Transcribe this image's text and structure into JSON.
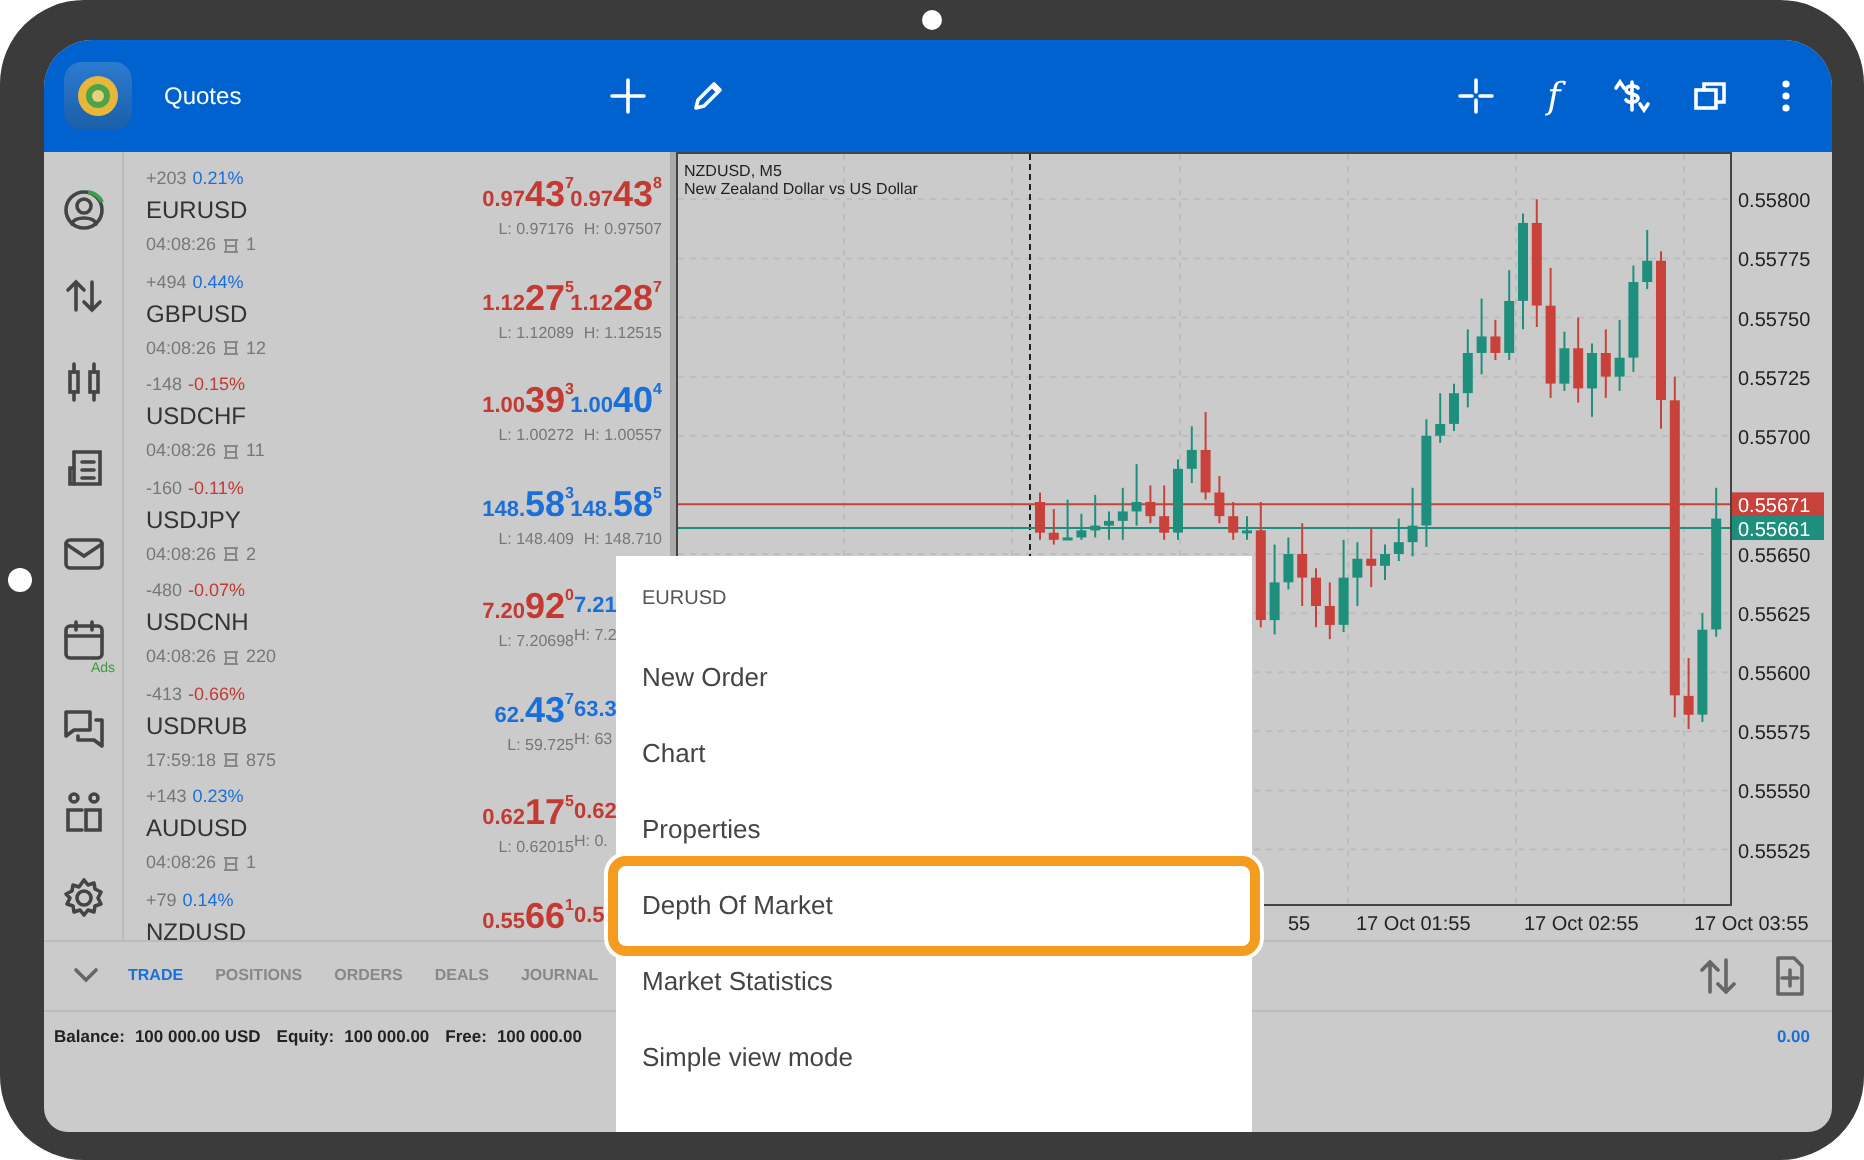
{
  "header": {
    "title": "Quotes",
    "indicator_symbol": "f"
  },
  "nav_rail": [
    {
      "kind": "account"
    },
    {
      "kind": "quotes"
    },
    {
      "kind": "chart"
    },
    {
      "kind": "trade"
    },
    {
      "kind": "mail"
    },
    {
      "kind": "calendar",
      "badge": "Ads"
    },
    {
      "kind": "chat"
    },
    {
      "kind": "community"
    },
    {
      "kind": "settings"
    }
  ],
  "quotes": [
    {
      "points": "+203",
      "percent": "0.21%",
      "rising": true,
      "symbol": "EURUSD",
      "time": "04:08:26",
      "spread": "1",
      "bid": {
        "prefix": "0.97",
        "big": "43",
        "sup": "7",
        "rising": false
      },
      "ask": {
        "prefix": "0.97",
        "big": "43",
        "sup": "8",
        "rising": false
      },
      "low": "L: 0.97176",
      "high": "H: 0.97507"
    },
    {
      "points": "+494",
      "percent": "0.44%",
      "rising": true,
      "symbol": "GBPUSD",
      "time": "04:08:26",
      "spread": "12",
      "bid": {
        "prefix": "1.12",
        "big": "27",
        "sup": "5",
        "rising": false
      },
      "ask": {
        "prefix": "1.12",
        "big": "28",
        "sup": "7",
        "rising": false
      },
      "low": "L: 1.12089",
      "high": "H: 1.12515"
    },
    {
      "points": "-148",
      "percent": "-0.15%",
      "rising": false,
      "symbol": "USDCHF",
      "time": "04:08:26",
      "spread": "11",
      "bid": {
        "prefix": "1.00",
        "big": "39",
        "sup": "3",
        "rising": false
      },
      "ask": {
        "prefix": "1.00",
        "big": "40",
        "sup": "4",
        "rising": true
      },
      "low": "L: 1.00272",
      "high": "H: 1.00557"
    },
    {
      "points": "-160",
      "percent": "-0.11%",
      "rising": false,
      "symbol": "USDJPY",
      "time": "04:08:26",
      "spread": "2",
      "bid": {
        "prefix": "148.",
        "big": "58",
        "sup": "3",
        "rising": true
      },
      "ask": {
        "prefix": "148.",
        "big": "58",
        "sup": "5",
        "rising": true
      },
      "low": "L: 148.409",
      "high": "H: 148.710"
    },
    {
      "points": "-480",
      "percent": "-0.07%",
      "rising": false,
      "symbol": "USDCNH",
      "time": "04:08:26",
      "spread": "220",
      "bid": {
        "prefix": "7.20",
        "big": "92",
        "sup": "0",
        "rising": false
      },
      "ask": {
        "prefix": "7.21",
        "rising": true
      },
      "low": "L: 7.20698",
      "high": "H: 7.2"
    },
    {
      "points": "-413",
      "percent": "-0.66%",
      "rising": false,
      "symbol": "USDRUB",
      "time": "17:59:18",
      "spread": "875",
      "bid": {
        "prefix": "62.",
        "big": "43",
        "sup": "7",
        "rising": true
      },
      "ask": {
        "prefix": "63.3",
        "rising": true
      },
      "low": "L: 59.725",
      "high": "H: 63"
    },
    {
      "points": "+143",
      "percent": "0.23%",
      "rising": true,
      "symbol": "AUDUSD",
      "time": "04:08:26",
      "spread": "1",
      "bid": {
        "prefix": "0.62",
        "big": "17",
        "sup": "5",
        "rising": false
      },
      "ask": {
        "prefix": "0.62",
        "rising": false
      },
      "low": "L: 0.62015",
      "high": "H: 0."
    },
    {
      "points": "+79",
      "percent": "0.14%",
      "rising": true,
      "symbol": "NZDUSD",
      "bid": {
        "prefix": "0.55",
        "big": "66",
        "sup": "1",
        "rising": false
      },
      "ask": {
        "prefix": "0.5",
        "rising": false
      }
    }
  ],
  "chart": {
    "symbol": "NZDUSD, M5",
    "description": "New Zealand Dollar vs US Dollar",
    "x_labels": [
      "55",
      "17 Oct 01:55",
      "17 Oct 02:55",
      "17 Oct 03:55"
    ],
    "chart_data": {
      "type": "candlestick",
      "grid": true,
      "ylim": [
        0.55502,
        0.5582
      ],
      "ohlc": [
        [
          0.55672,
          0.55676,
          0.55656,
          0.55659
        ],
        [
          0.55659,
          0.55669,
          0.55654,
          0.55656
        ],
        [
          0.55656,
          0.55673,
          0.55656,
          0.55657
        ],
        [
          0.55657,
          0.55667,
          0.55656,
          0.5566
        ],
        [
          0.5566,
          0.55675,
          0.55657,
          0.55662
        ],
        [
          0.55662,
          0.55668,
          0.55656,
          0.55664
        ],
        [
          0.55664,
          0.55678,
          0.55656,
          0.55668
        ],
        [
          0.55668,
          0.55688,
          0.55662,
          0.55672
        ],
        [
          0.55672,
          0.55679,
          0.55663,
          0.55666
        ],
        [
          0.55666,
          0.55679,
          0.55656,
          0.55659
        ],
        [
          0.55659,
          0.5569,
          0.55656,
          0.55686
        ],
        [
          0.55686,
          0.55704,
          0.5568,
          0.55694
        ],
        [
          0.55694,
          0.5571,
          0.55673,
          0.55676
        ],
        [
          0.55676,
          0.55683,
          0.55663,
          0.55666
        ],
        [
          0.55666,
          0.55672,
          0.55656,
          0.55659
        ],
        [
          0.55659,
          0.55666,
          0.55656,
          0.5566
        ],
        [
          0.5566,
          0.55672,
          0.55619,
          0.55622
        ],
        [
          0.55622,
          0.55654,
          0.55616,
          0.55638
        ],
        [
          0.55638,
          0.55657,
          0.55635,
          0.5565
        ],
        [
          0.5565,
          0.55663,
          0.55628,
          0.5564
        ],
        [
          0.5564,
          0.55644,
          0.55619,
          0.55628
        ],
        [
          0.55628,
          0.55638,
          0.55614,
          0.5562
        ],
        [
          0.5562,
          0.55656,
          0.55617,
          0.5564
        ],
        [
          0.5564,
          0.55655,
          0.55628,
          0.55648
        ],
        [
          0.55648,
          0.55661,
          0.55636,
          0.55645
        ],
        [
          0.55645,
          0.55654,
          0.55639,
          0.5565
        ],
        [
          0.5565,
          0.55665,
          0.55647,
          0.55655
        ],
        [
          0.55655,
          0.55678,
          0.55649,
          0.55662
        ],
        [
          0.55662,
          0.55707,
          0.55653,
          0.557
        ],
        [
          0.557,
          0.55718,
          0.55697,
          0.55705
        ],
        [
          0.55705,
          0.55722,
          0.55702,
          0.55718
        ],
        [
          0.55718,
          0.55745,
          0.55712,
          0.55735
        ],
        [
          0.55735,
          0.55758,
          0.55726,
          0.55742
        ],
        [
          0.55742,
          0.55749,
          0.55732,
          0.55735
        ],
        [
          0.55735,
          0.5577,
          0.55732,
          0.55757
        ],
        [
          0.55757,
          0.55794,
          0.55745,
          0.5579
        ],
        [
          0.5579,
          0.558,
          0.55746,
          0.55755
        ],
        [
          0.55755,
          0.55771,
          0.55716,
          0.55722
        ],
        [
          0.55722,
          0.55744,
          0.55719,
          0.55737
        ],
        [
          0.55737,
          0.5575,
          0.55714,
          0.5572
        ],
        [
          0.5572,
          0.55739,
          0.55708,
          0.55735
        ],
        [
          0.55735,
          0.55745,
          0.55716,
          0.55725
        ],
        [
          0.55725,
          0.55749,
          0.55719,
          0.55733
        ],
        [
          0.55733,
          0.55772,
          0.55727,
          0.55765
        ],
        [
          0.55765,
          0.55787,
          0.55762,
          0.55774
        ],
        [
          0.55774,
          0.55778,
          0.55703,
          0.55715
        ],
        [
          0.55715,
          0.55725,
          0.55581,
          0.5559
        ],
        [
          0.5559,
          0.55606,
          0.55576,
          0.55582
        ],
        [
          0.55582,
          0.55625,
          0.55579,
          0.55618
        ],
        [
          0.55618,
          0.55678,
          0.55615,
          0.55665
        ]
      ],
      "yticks": [
        {
          "value": 0.558,
          "label": "0.55800"
        },
        {
          "value": 0.55775,
          "label": "0.55775"
        },
        {
          "value": 0.5575,
          "label": "0.55750"
        },
        {
          "value": 0.55725,
          "label": "0.55725"
        },
        {
          "value": 0.557,
          "label": "0.55700"
        },
        {
          "value": 0.5565,
          "label": "0.55650"
        },
        {
          "value": 0.55625,
          "label": "0.55625"
        },
        {
          "value": 0.556,
          "label": "0.55600"
        },
        {
          "value": 0.55575,
          "label": "0.55575"
        },
        {
          "value": 0.5555,
          "label": "0.55550"
        },
        {
          "value": 0.55525,
          "label": "0.55525"
        }
      ],
      "ref_lines": [
        {
          "axis": "y",
          "value": 0.55671,
          "label": "0.55671",
          "color": "#c8413a"
        },
        {
          "axis": "y",
          "value": 0.55661,
          "label": "0.55661",
          "color": "#1f8f7d"
        }
      ]
    }
  },
  "menu": {
    "title": "EURUSD",
    "items": [
      {
        "label": "New Order",
        "highlighted": false
      },
      {
        "label": "Chart",
        "highlighted": false
      },
      {
        "label": "Properties",
        "highlighted": false
      },
      {
        "label": "Depth Of Market",
        "highlighted": true
      },
      {
        "label": "Market Statistics",
        "highlighted": false
      },
      {
        "label": "Simple view mode",
        "highlighted": false
      }
    ]
  },
  "bottom_tabs": [
    {
      "label": "TRADE",
      "selected": true
    },
    {
      "label": "POSITIONS",
      "selected": false
    },
    {
      "label": "ORDERS",
      "selected": false
    },
    {
      "label": "DEALS",
      "selected": false
    },
    {
      "label": "JOURNAL",
      "selected": false
    }
  ],
  "account": [
    {
      "label": "Balance:",
      "value": "100 000.00 USD"
    },
    {
      "label": "Equity:",
      "value": "100 000.00"
    },
    {
      "label": "Free:",
      "value": "100 000.00"
    }
  ],
  "profit": "0.00"
}
